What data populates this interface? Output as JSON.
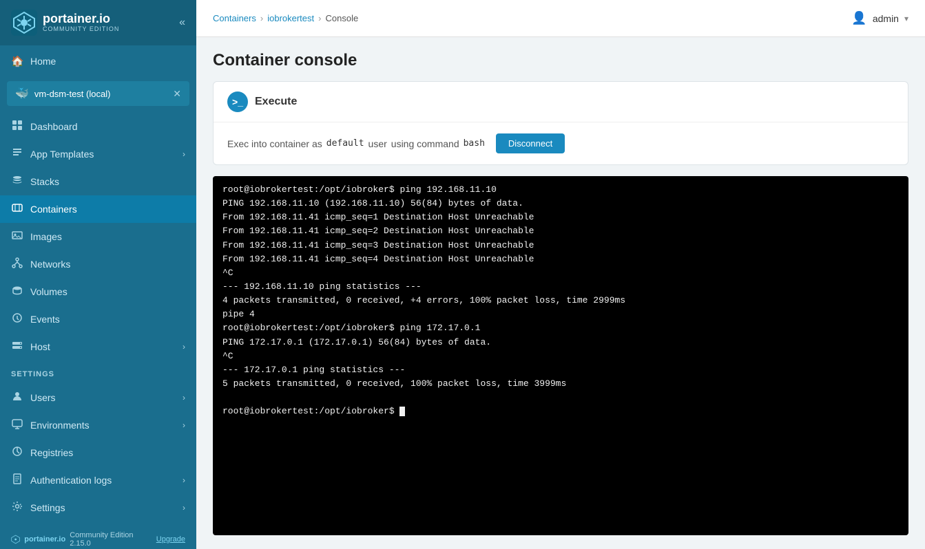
{
  "sidebar": {
    "logo": {
      "title": "portainer.io",
      "subtitle": "COMMUNITY EDITION"
    },
    "collapse_label": "«",
    "env": {
      "name": "vm-dsm-test (local)",
      "close": "✕"
    },
    "nav_items": [
      {
        "id": "home",
        "label": "Home",
        "icon": "🏠",
        "active": false
      },
      {
        "id": "dashboard",
        "label": "Dashboard",
        "icon": "⊞",
        "active": false
      },
      {
        "id": "app-templates",
        "label": "App Templates",
        "icon": "✎",
        "active": false,
        "chevron": "⌄"
      },
      {
        "id": "stacks",
        "label": "Stacks",
        "icon": "⊕",
        "active": false
      },
      {
        "id": "containers",
        "label": "Containers",
        "icon": "◻",
        "active": true
      },
      {
        "id": "images",
        "label": "Images",
        "icon": "⊟",
        "active": false
      },
      {
        "id": "networks",
        "label": "Networks",
        "icon": "⊸",
        "active": false
      },
      {
        "id": "volumes",
        "label": "Volumes",
        "icon": "▭",
        "active": false
      },
      {
        "id": "events",
        "label": "Events",
        "icon": "⊙",
        "active": false
      },
      {
        "id": "host",
        "label": "Host",
        "icon": "▤",
        "active": false,
        "chevron": "⌄"
      }
    ],
    "settings_label": "Settings",
    "settings_items": [
      {
        "id": "users",
        "label": "Users",
        "icon": "👤",
        "chevron": "⌄"
      },
      {
        "id": "environments",
        "label": "Environments",
        "icon": "🖥",
        "chevron": "⌄"
      },
      {
        "id": "registries",
        "label": "Registries",
        "icon": "◈"
      },
      {
        "id": "auth-logs",
        "label": "Authentication logs",
        "icon": "📄",
        "chevron": "⌄"
      },
      {
        "id": "settings",
        "label": "Settings",
        "icon": "⚙",
        "chevron": "⌄"
      }
    ],
    "footer": {
      "logo_text": "portainer.io",
      "edition": "Community Edition 2.15.0",
      "upgrade": "Upgrade"
    }
  },
  "topbar": {
    "breadcrumb": [
      {
        "label": "Containers",
        "link": true
      },
      {
        "label": "iobrokertest",
        "link": true
      },
      {
        "label": "Console",
        "link": false
      }
    ],
    "user": {
      "name": "admin",
      "chevron": "▾"
    }
  },
  "page": {
    "title": "Container console"
  },
  "execute_card": {
    "title": "Execute",
    "exec_prefix": "Exec into container as",
    "user": "default",
    "user_label": "user",
    "using_command": "using command",
    "command": "bash",
    "disconnect_label": "Disconnect"
  },
  "terminal": {
    "lines": [
      "root@iobrokertest:/opt/iobroker$ ping 192.168.11.10",
      "PING 192.168.11.10 (192.168.11.10) 56(84) bytes of data.",
      "From 192.168.11.41 icmp_seq=1 Destination Host Unreachable",
      "From 192.168.11.41 icmp_seq=2 Destination Host Unreachable",
      "From 192.168.11.41 icmp_seq=3 Destination Host Unreachable",
      "From 192.168.11.41 icmp_seq=4 Destination Host Unreachable",
      "^C",
      "--- 192.168.11.10 ping statistics ---",
      "4 packets transmitted, 0 received, +4 errors, 100% packet loss, time 2999ms",
      "pipe 4",
      "root@iobrokertest:/opt/iobroker$ ping 172.17.0.1",
      "PING 172.17.0.1 (172.17.0.1) 56(84) bytes of data.",
      "^C",
      "--- 172.17.0.1 ping statistics ---",
      "5 packets transmitted, 0 received, 100% packet loss, time 3999ms",
      "",
      "root@iobrokertest:/opt/iobroker$ "
    ]
  }
}
